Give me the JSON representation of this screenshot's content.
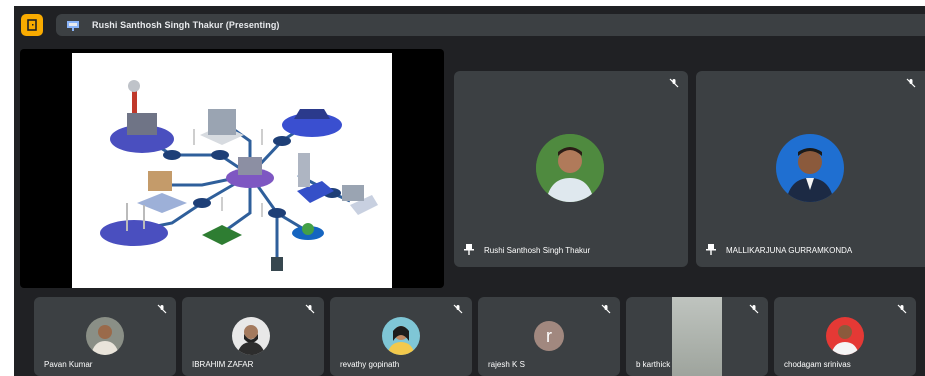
{
  "header": {
    "presenting_label": "Rushi Santhosh Singh Thakur (Presenting)",
    "room_icon": "door-icon",
    "presentation_icon": "presentation-icon"
  },
  "colors": {
    "stage_bg": "#202124",
    "tile_bg": "#3c4043",
    "accent": "#f9ab00"
  },
  "featured": [
    {
      "name": "Rushi Santhosh Singh Thakur",
      "pinned": true,
      "muted": true
    },
    {
      "name": "MALLIKARJUNA GURRAMKONDA",
      "pinned": true,
      "muted": true
    }
  ],
  "participants": [
    {
      "name": "Pavan Kumar",
      "muted": true
    },
    {
      "name": "IBRAHIM ZAFAR",
      "muted": true
    },
    {
      "name": "revathy gopinath",
      "muted": true
    },
    {
      "name": "rajesh K S",
      "avatar_letter": "r",
      "muted": true
    },
    {
      "name": "b karthick",
      "muted": true
    },
    {
      "name": "chodagam srinivas",
      "muted": true
    }
  ]
}
